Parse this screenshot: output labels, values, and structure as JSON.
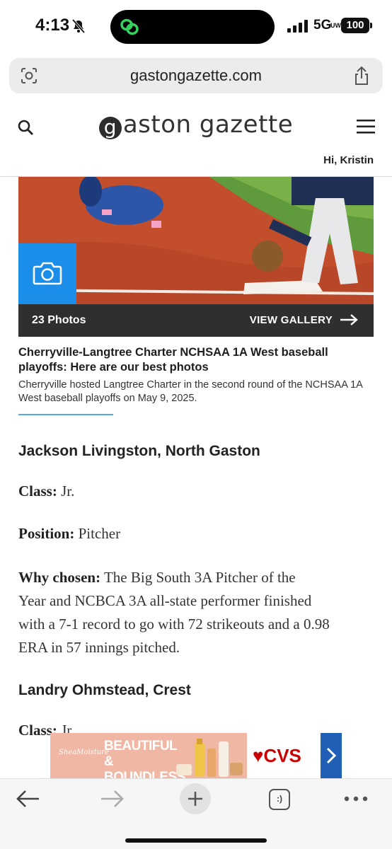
{
  "status_bar": {
    "time": "4:13",
    "network": "5G",
    "network_sub": "UW",
    "battery": "100"
  },
  "browser": {
    "url": "gastongazette.com",
    "tab_count_label": ":)"
  },
  "site": {
    "logo_mark": "g",
    "logo_rest": "aston gazette",
    "greeting": "Hi, Kristin"
  },
  "gallery": {
    "photo_count": "23 Photos",
    "view_label": "VIEW GALLERY",
    "title": "Cherryville-Langtree Charter NCHSAA 1A West baseball playoffs: Here are our best photos",
    "description": "Cherryville hosted Langtree Charter in the second round of the NCHSAA 1A West baseball playoffs on May 9, 2025.",
    "accent_color": "#1a8ee8"
  },
  "article": {
    "players": [
      {
        "name": "Jackson Livingston, North Gaston",
        "class_label": "Class:",
        "class_value": "Jr.",
        "position_label": "Position:",
        "position_value": "Pitcher",
        "why_label": "Why chosen:",
        "why_lines": [
          "The Big South 3A Pitcher of the",
          "Year and NCBCA 3A all-state performer finished",
          "with a 7-1 record to go with 72 strikeouts and a 0.98",
          "ERA in 57 innings pitched."
        ]
      },
      {
        "name": "Landry Ohmstead, Crest",
        "class_label": "Class:",
        "class_value": "Jr."
      }
    ]
  },
  "ad": {
    "brand": "SheaMoisture",
    "headline": "BEAUTIFUL & BOUNDLESS",
    "retailer": "CVS"
  }
}
